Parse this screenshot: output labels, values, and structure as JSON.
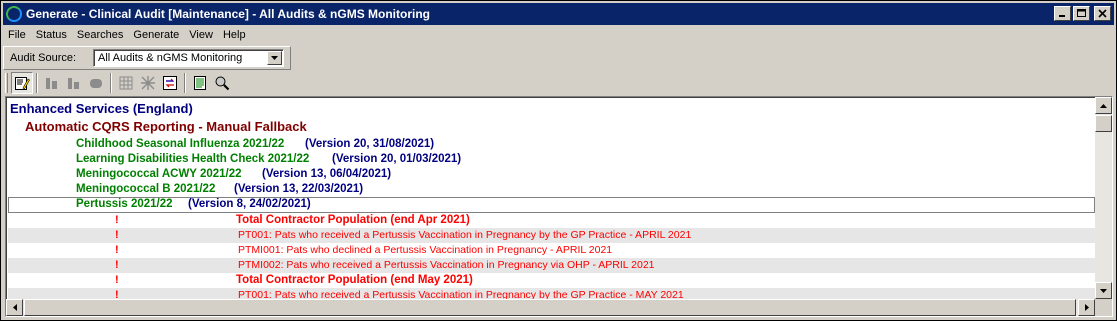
{
  "window": {
    "title": "Generate - Clinical Audit [Maintenance] - All Audits & nGMS Monitoring"
  },
  "menu": [
    "File",
    "Status",
    "Searches",
    "Generate",
    "View",
    "Help"
  ],
  "audit_source": {
    "label": "Audit Source:",
    "value": "All Audits & nGMS Monitoring"
  },
  "toolbar_icons": [
    "edit-icon",
    "report-bars-icon",
    "report-bars-alt-icon",
    "stop-icon",
    "grid-icon",
    "grid-alt-icon",
    "compare-icon",
    "list-icon",
    "search-icon"
  ],
  "tree": {
    "service": "Enhanced Services (England)",
    "group": "Automatic CQRS Reporting - Manual Fallback",
    "audits": [
      {
        "name": "Childhood Seasonal Influenza 2021/22",
        "version": "(Version 20, 31/08/2021)"
      },
      {
        "name": "Learning Disabilities Health Check 2021/22",
        "version": "(Version 20, 01/03/2021)"
      },
      {
        "name": "Meningococcal ACWY 2021/22",
        "version": "(Version 13, 06/04/2021)"
      },
      {
        "name": "Meningococcal B 2021/22",
        "version": "(Version 13, 22/03/2021)"
      },
      {
        "name": "Pertussis 2021/22",
        "version": "(Version 8, 24/02/2021)"
      }
    ],
    "rows": [
      {
        "flag": "!",
        "text": "Total Contractor Population (end Apr 2021)",
        "style": "header"
      },
      {
        "flag": "!",
        "text": "PT001: Pats who received a Pertussis Vaccination in Pregnancy by the GP Practice - APRIL 2021",
        "style": "item"
      },
      {
        "flag": "!",
        "text": "PTMI001: Pats who declined a Pertussis Vaccination in Pregnancy - APRIL 2021",
        "style": "item"
      },
      {
        "flag": "!",
        "text": "PTMI002: Pats who received a Pertussis Vaccination in Pregnancy via OHP - APRIL 2021",
        "style": "item"
      },
      {
        "flag": "!",
        "text": "Total Contractor Population (end May 2021)",
        "style": "header"
      },
      {
        "flag": "!",
        "text": "PT001: Pats who received a Pertussis Vaccination in Pregnancy by the GP Practice - MAY 2021",
        "style": "item"
      }
    ]
  }
}
